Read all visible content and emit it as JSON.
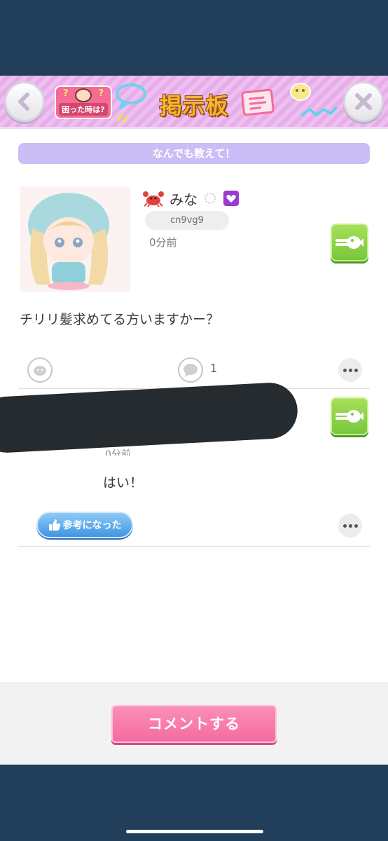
{
  "header": {
    "title": "掲示板",
    "help_label": "困った時は?"
  },
  "board": {
    "category": "なんでも教えて！"
  },
  "post": {
    "username": "みな",
    "user_id": "cn9vg9",
    "time": "0分前",
    "text": "チリリ髪求めてる方いますかー？",
    "comment_count": "1"
  },
  "reply": {
    "time_fragment": "0分前",
    "text": "はい！",
    "helpful_label": "参考になった"
  },
  "footer": {
    "comment_button": "コメントする"
  },
  "colors": {
    "header_pink": "#eebff0",
    "category_purple": "#cbbdf6",
    "action_green": "#78c73c",
    "comment_pink": "#f56b9f",
    "helpful_blue": "#3f95e3",
    "frame_navy": "#213f5b"
  },
  "icons": [
    "back-icon",
    "close-icon",
    "crab-icon",
    "sparkle-icon",
    "heart-icon",
    "fish-icon",
    "stamp-icon",
    "speech-bubble-icon",
    "more-icon",
    "thumbs-up-icon"
  ]
}
